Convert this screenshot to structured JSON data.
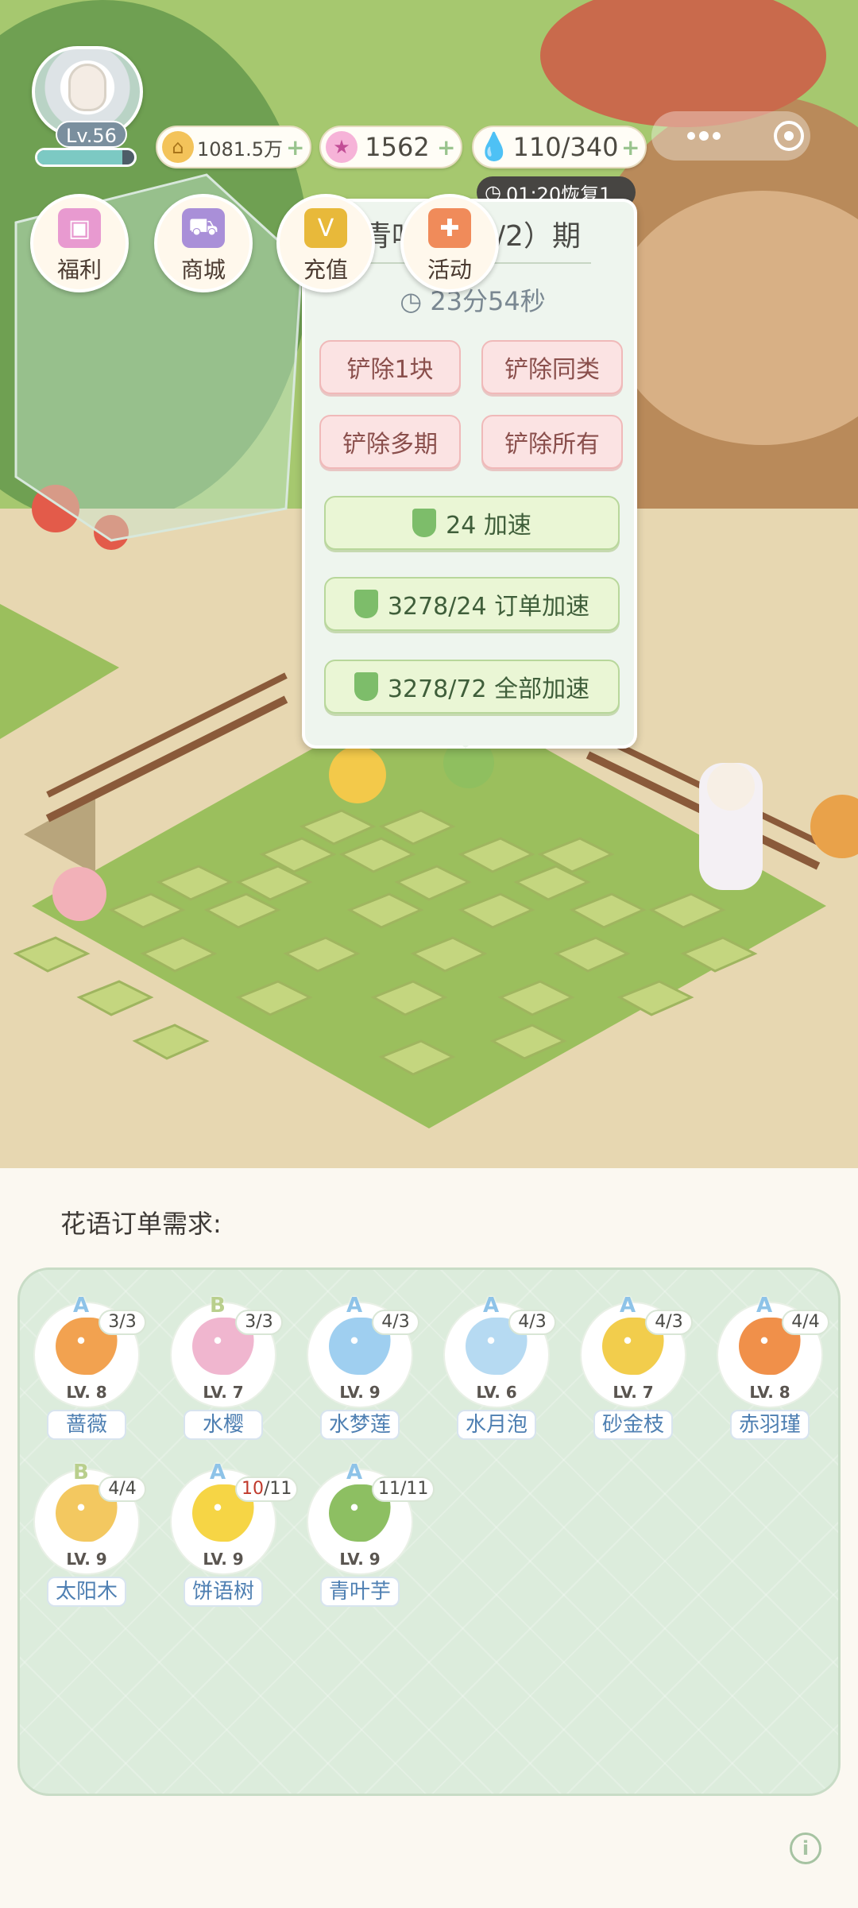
{
  "player": {
    "level": "Lv.56",
    "xp_fraction": 0.88
  },
  "resources": {
    "gold": "1081.5万",
    "stars": "1562",
    "water": "110/340",
    "plus": "+",
    "water_timer": "01:20恢复1"
  },
  "nav": [
    {
      "label": "福利",
      "icon": "gift-icon",
      "color": "#e89ad0"
    },
    {
      "label": "商城",
      "icon": "shopping-cart-icon",
      "color": "#a98fd8"
    },
    {
      "label": "充值",
      "icon": "v-badge-icon",
      "color": "#e8b93a"
    },
    {
      "label": "活动",
      "icon": "gamepad-icon",
      "color": "#f08b5a"
    }
  ],
  "popup": {
    "title": "青叶芋（2/2）期",
    "time_icon": "clock-icon",
    "time_left": "23分54秒",
    "buttons": {
      "remove_one": "铲除1块",
      "remove_same": "铲除同类",
      "remove_multi": "铲除多期",
      "remove_all": "铲除所有",
      "speed_up": "24 加速",
      "order_speed": "3278/24 订单加速",
      "all_speed": "3278/72 全部加速"
    }
  },
  "orders": {
    "title": "花语订单需求:",
    "items": [
      {
        "grade": "A",
        "qty": "3/3",
        "lv": "LV. 8",
        "name": "蔷薇",
        "color": "#f2a250"
      },
      {
        "grade": "B",
        "qty": "3/3",
        "lv": "LV. 7",
        "name": "水樱",
        "color": "#f0b6cf"
      },
      {
        "grade": "A",
        "qty": "4/3",
        "lv": "LV. 9",
        "name": "水梦莲",
        "color": "#9fcff0"
      },
      {
        "grade": "A",
        "qty": "4/3",
        "lv": "LV. 6",
        "name": "水月泡",
        "color": "#b6daf2"
      },
      {
        "grade": "A",
        "qty": "4/3",
        "lv": "LV. 7",
        "name": "砂金枝",
        "color": "#f2cd4c"
      },
      {
        "grade": "A",
        "qty": "4/4",
        "lv": "LV. 8",
        "name": "赤羽瑾",
        "color": "#f0904a"
      },
      {
        "grade": "B",
        "qty": "4/4",
        "lv": "LV. 9",
        "name": "太阳木",
        "color": "#f3c860"
      },
      {
        "grade": "A",
        "qty": "10/11",
        "qty_short": "10",
        "qty_total": "/11",
        "lv": "LV. 9",
        "name": "饼语树",
        "color": "#f6d545"
      },
      {
        "grade": "A",
        "qty": "11/11",
        "lv": "LV. 9",
        "name": "青叶芋",
        "color": "#8dbf62"
      }
    ]
  },
  "info_icon": "info-icon",
  "info_label": "i"
}
